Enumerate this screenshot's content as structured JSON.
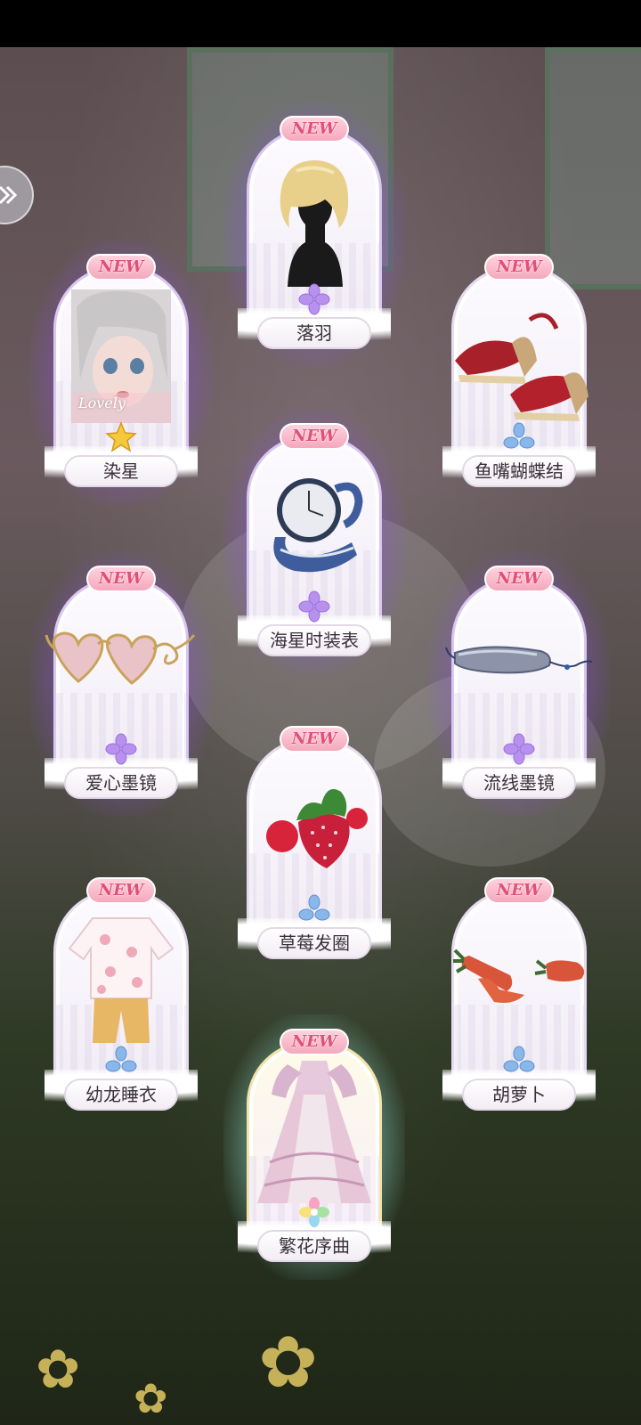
{
  "cards": [
    {
      "name": "落羽",
      "badge": "NEW",
      "rarity": "purple",
      "item": "wig-icon"
    },
    {
      "name": "染星",
      "badge": "NEW",
      "rarity": "gold-star",
      "item": "makeup-portrait-icon",
      "portrait_text": "Lovely"
    },
    {
      "name": "鱼嘴蝴蝶结",
      "badge": "NEW",
      "rarity": "blue",
      "item": "sandals-icon"
    },
    {
      "name": "海星时装表",
      "badge": "NEW",
      "rarity": "purple",
      "item": "watch-icon"
    },
    {
      "name": "爱心墨镜",
      "badge": "NEW",
      "rarity": "purple",
      "item": "heart-sunglasses-icon"
    },
    {
      "name": "流线墨镜",
      "badge": "NEW",
      "rarity": "purple",
      "item": "visor-sunglasses-icon"
    },
    {
      "name": "草莓发圈",
      "badge": "NEW",
      "rarity": "blue",
      "item": "strawberry-hair-tie-icon"
    },
    {
      "name": "幼龙睡衣",
      "badge": "NEW",
      "rarity": "blue",
      "item": "pajamas-icon"
    },
    {
      "name": "胡萝卜",
      "badge": "NEW",
      "rarity": "blue",
      "item": "carrot-hairpins-icon"
    },
    {
      "name": "繁花序曲",
      "badge": "NEW",
      "rarity": "rainbow",
      "item": "gown-icon"
    }
  ],
  "colors": {
    "purple_glow": "#aa6eff",
    "gold_glow": "#ffdc78",
    "new_text": "#e2507a",
    "name_text": "#3a3038"
  }
}
